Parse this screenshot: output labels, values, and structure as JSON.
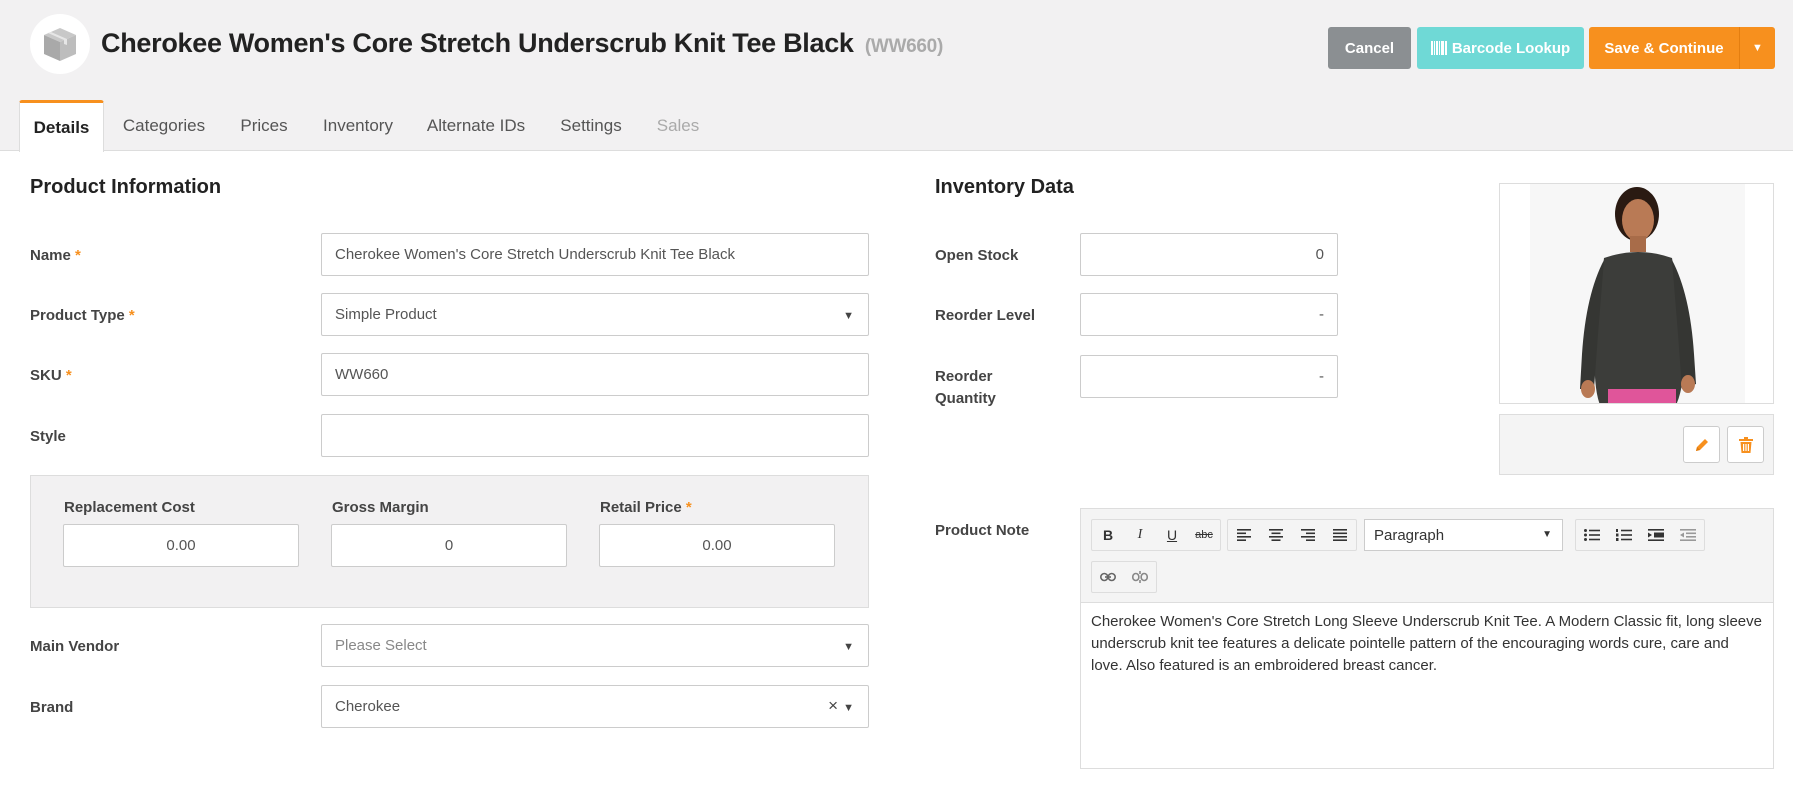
{
  "header": {
    "title": "Cherokee Women's Core Stretch Underscrub Knit Tee Black",
    "code": "(WW660)",
    "cancel_label": "Cancel",
    "barcode_label": "Barcode Lookup",
    "save_label": "Save & Continue",
    "caret": "▼"
  },
  "tabs": [
    {
      "label": "Details"
    },
    {
      "label": "Categories"
    },
    {
      "label": "Prices"
    },
    {
      "label": "Inventory"
    },
    {
      "label": "Alternate IDs"
    },
    {
      "label": "Settings"
    },
    {
      "label": "Sales"
    }
  ],
  "product_info": {
    "section_title": "Product Information",
    "required_mark": "*",
    "name": {
      "label": "Name",
      "value": "Cherokee Women's Core Stretch Underscrub Knit Tee Black"
    },
    "product_type": {
      "label": "Product Type",
      "value": "Simple Product"
    },
    "sku": {
      "label": "SKU",
      "value": "WW660"
    },
    "style": {
      "label": "Style",
      "value": ""
    },
    "replacement_cost": {
      "label": "Replacement Cost",
      "value": "0.00"
    },
    "gross_margin": {
      "label": "Gross Margin",
      "value": "0"
    },
    "retail_price": {
      "label": "Retail Price",
      "value": "0.00"
    },
    "main_vendor": {
      "label": "Main Vendor",
      "placeholder": "Please Select"
    },
    "brand": {
      "label": "Brand",
      "value": "Cherokee",
      "clear": "×"
    }
  },
  "inventory_data": {
    "section_title": "Inventory Data",
    "open_stock": {
      "label": "Open Stock",
      "value": "0"
    },
    "reorder_level": {
      "label": "Reorder Level",
      "value": "-"
    },
    "reorder_quantity": {
      "label_line1": "Reorder",
      "label_line2": "Quantity",
      "value": "-"
    }
  },
  "product_note": {
    "label": "Product Note",
    "format_select": "Paragraph",
    "text": "Cherokee Women's Core Stretch Long Sleeve Underscrub Knit Tee. A Modern Classic fit, long sleeve underscrub knit tee features a delicate pointelle pattern of the encouraging words cure, care and love. Also featured is an embroidered breast cancer."
  },
  "colors": {
    "accent": "#f7901e",
    "teal": "#6fd9d6",
    "gray_button": "#8b8f92"
  }
}
